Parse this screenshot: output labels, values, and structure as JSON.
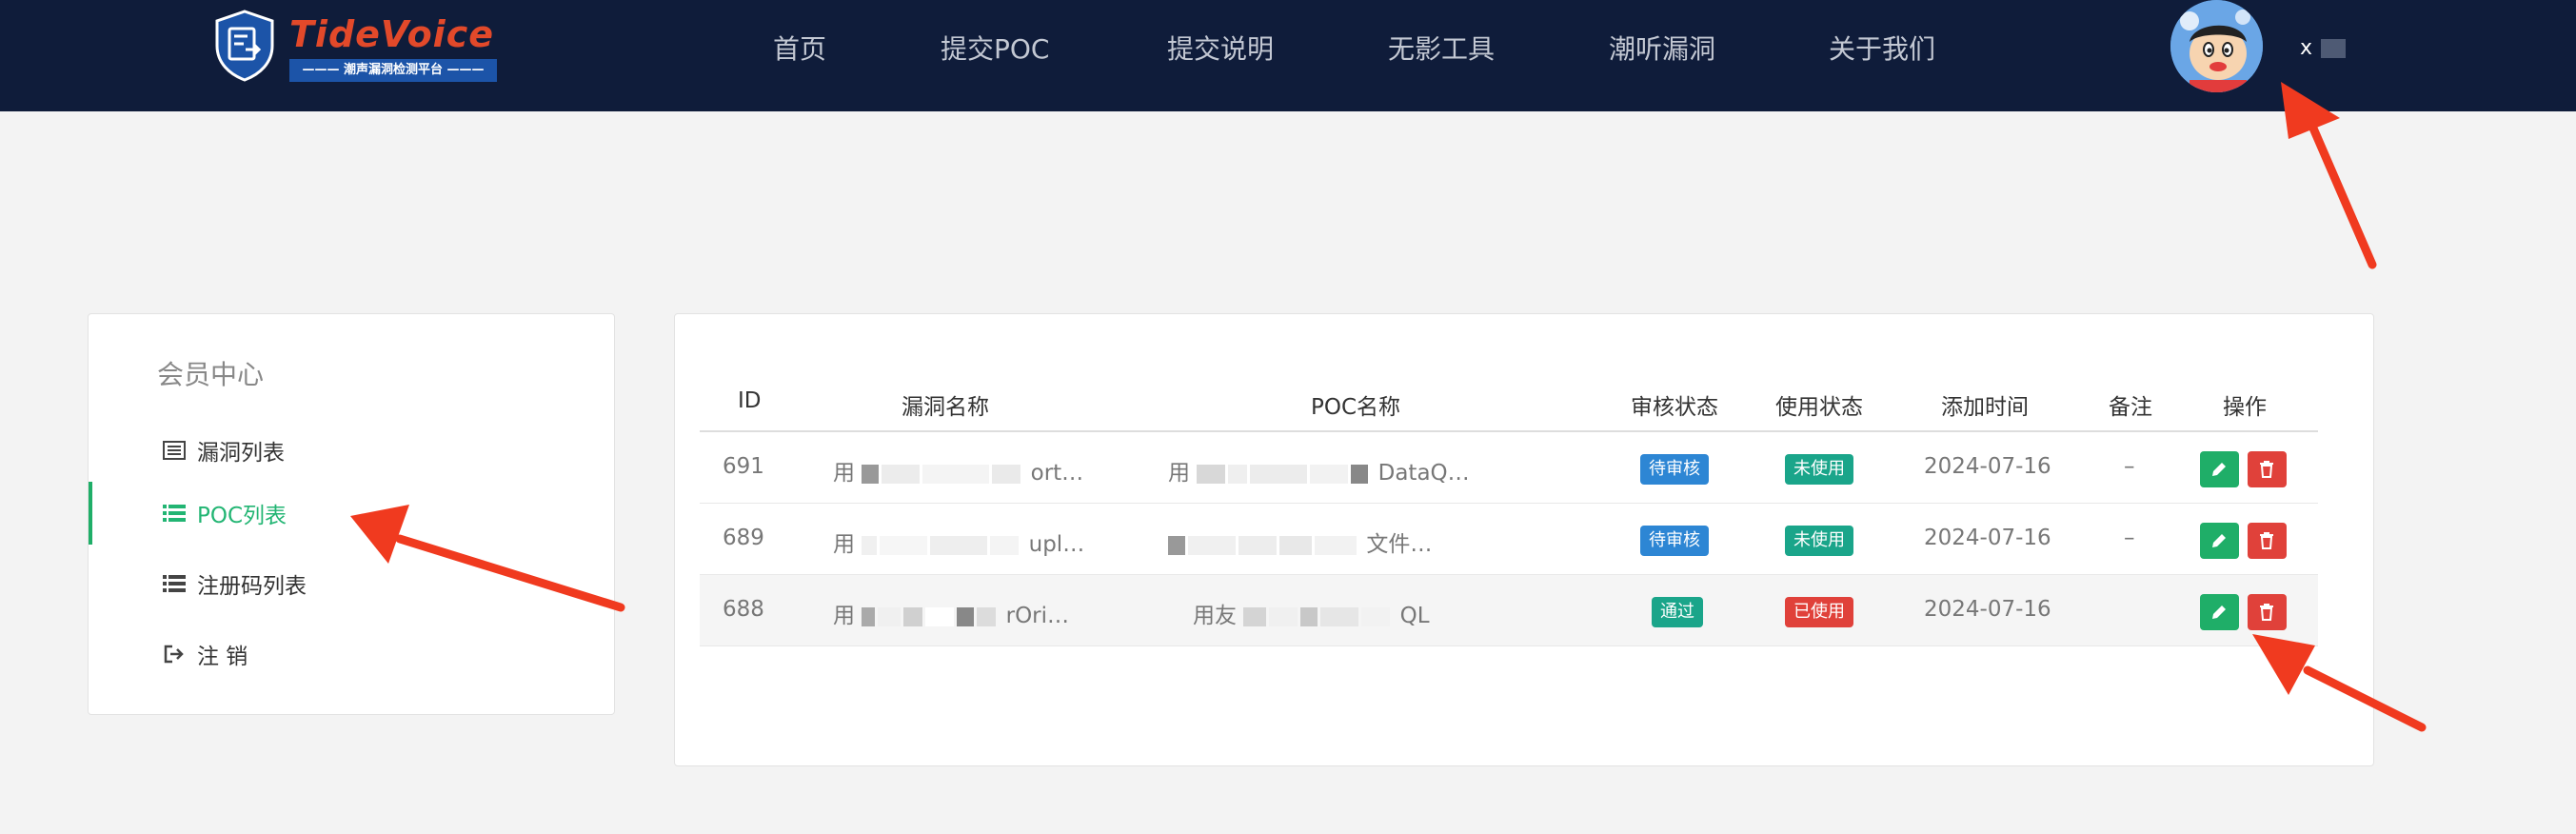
{
  "header": {
    "logo_title": "TideVoice",
    "logo_tagline": "——— 潮声漏洞检测平台 ———",
    "nav": [
      "首页",
      "提交POC",
      "提交说明",
      "无影工具",
      "潮听漏洞",
      "关于我们"
    ],
    "username": "x"
  },
  "sidebar": {
    "title": "会员中心",
    "items": [
      {
        "label": "漏洞列表",
        "icon": "list-alt-icon",
        "active": false
      },
      {
        "label": "POC列表",
        "icon": "list-icon",
        "active": true
      },
      {
        "label": "注册码列表",
        "icon": "list-icon",
        "active": false
      },
      {
        "label": "注 销",
        "icon": "sign-out-icon",
        "active": false
      }
    ]
  },
  "table": {
    "columns": [
      "ID",
      "漏洞名称",
      "POC名称",
      "审核状态",
      "使用状态",
      "添加时间",
      "备注",
      "操作"
    ],
    "rows": [
      {
        "id": "691",
        "vuln_start": "用",
        "vuln_end": "ort…",
        "poc_start": "用",
        "poc_end": "DataQ…",
        "review": "待审核",
        "usage": "未使用",
        "date": "2024-07-16",
        "remark": "–"
      },
      {
        "id": "689",
        "vuln_start": "用",
        "vuln_end": "upl…",
        "poc_start": "",
        "poc_end": "文件…",
        "review": "待审核",
        "usage": "未使用",
        "date": "2024-07-16",
        "remark": "–"
      },
      {
        "id": "688",
        "vuln_start": "用",
        "vuln_end": "rOri…",
        "poc_start": "用友",
        "poc_end": "QL",
        "review": "通过",
        "usage": "已使用",
        "date": "2024-07-16",
        "remark": ""
      }
    ]
  },
  "colors": {
    "navbar": "#0f1c3a",
    "accent_green": "#1fae68",
    "badge_blue": "#2d86d4",
    "badge_teal": "#1aa58a",
    "badge_red": "#e0413a",
    "annotation_red": "#f03a1f"
  }
}
